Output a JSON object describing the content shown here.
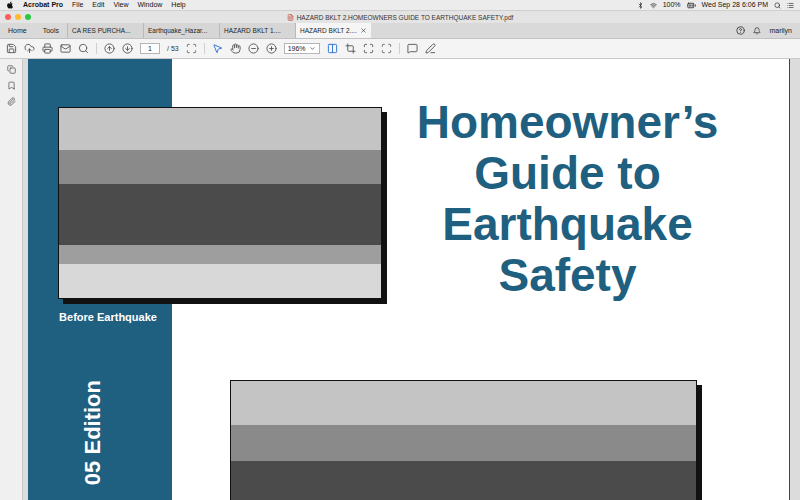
{
  "menubar": {
    "app": "Acrobat Pro",
    "menus": [
      "File",
      "Edit",
      "View",
      "Window",
      "Help"
    ],
    "battery": "100%",
    "clock": "Wed Sep 28 6:06 PM"
  },
  "window": {
    "title": "HAZARD BKLT 2.HOMEOWNERS GUIDE TO EARTHQUAKE SAFETY.pdf"
  },
  "nav": [
    "Home",
    "Tools"
  ],
  "tabs": [
    {
      "label": "CA RES PURCHA...",
      "selected": false
    },
    {
      "label": "Earthquake_Hazar...",
      "selected": false
    },
    {
      "label": "HAZARD BKLT 1....",
      "selected": false
    },
    {
      "label": "HAZARD BKLT 2....",
      "selected": true
    }
  ],
  "user": "marilyn",
  "toolbar": {
    "page": "1",
    "page_count": "/ 53",
    "zoom": "196%"
  },
  "document": {
    "title_lines": [
      "Homeowner’s",
      "Guide to",
      "Earthquake",
      "Safety"
    ],
    "before_caption": "Before Earthquake",
    "edition": "05 Edition"
  }
}
